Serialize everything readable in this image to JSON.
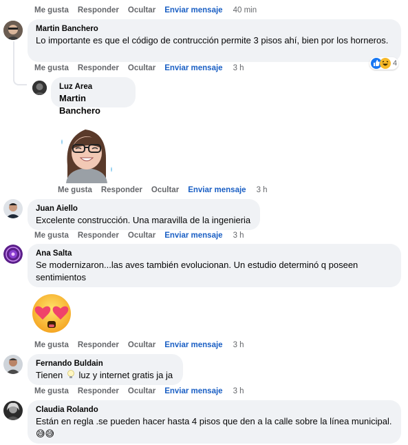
{
  "actions": {
    "like": "Me gusta",
    "reply": "Responder",
    "hide": "Ocultar",
    "send_message": "Enviar mensaje"
  },
  "top_row": {
    "time": "40 min"
  },
  "comments": [
    {
      "author": "Martin Banchero",
      "text": "Lo importante es que el código de contrucción permite 3 pisos ahí, bien por los horneros.",
      "time": "3 h",
      "reaction_count": "4"
    },
    {
      "author": "Luz Area",
      "text": "Martin Banchero",
      "time": "3 h",
      "sticker": "memoji-woman-laughing-tears"
    },
    {
      "author": "Juan Aiello",
      "text": "Excelente construcción. Una maravilla de la ingenieria",
      "time": "3 h"
    },
    {
      "author": "Ana Salta",
      "text": "Se modernizaron...las aves también evolucionan. Un estudio determinó q poseen sentimientos",
      "time": "3 h",
      "sticker": "heart-eyes-emoji"
    },
    {
      "author": "Fernando Buldain",
      "text_before": "Tienen",
      "text_after": "luz y internet gratis ja ja",
      "inline_icon": "light-bulb-emoji",
      "time": "3 h"
    },
    {
      "author": "Claudia Rolando",
      "text": "Están en regla .se pueden hacer hasta 4 pisos que den a la calle sobre la línea municipal.",
      "time": "3 h",
      "trailing": "😅😅"
    }
  ]
}
